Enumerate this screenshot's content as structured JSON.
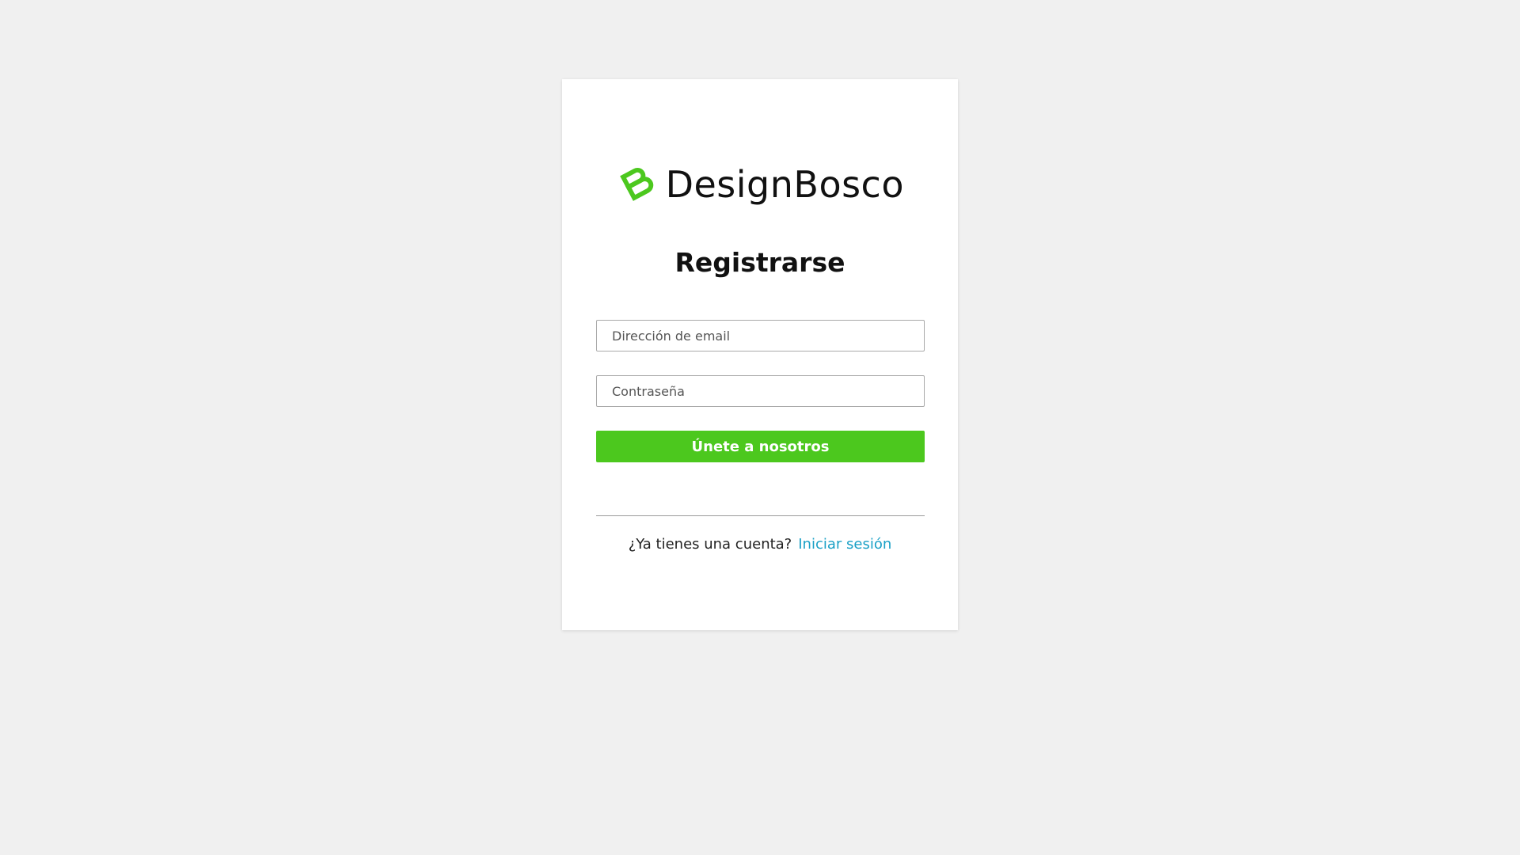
{
  "brand": {
    "name": "DesignBosco",
    "accent_color": "#4cc81e",
    "logo_icon": "designbosco-logo-icon"
  },
  "form": {
    "title": "Registrarse",
    "email_placeholder": "Dirección de email",
    "password_placeholder": "Contraseña",
    "submit_label": "Únete a nosotros"
  },
  "footer": {
    "prompt": "¿Ya tienes una cuenta?",
    "login_link": "Iniciar sesión",
    "link_color": "#1aa0c6"
  }
}
